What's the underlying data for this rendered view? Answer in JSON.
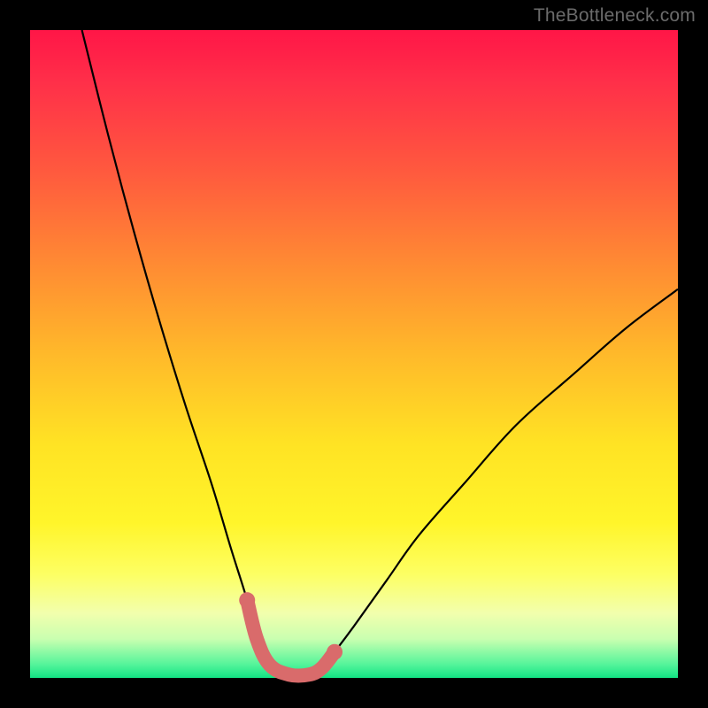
{
  "watermark": "TheBottleneck.com",
  "colors": {
    "frame": "#000000",
    "curve": "#000000",
    "highlight": "#d96b6b",
    "gradient_top": "#ff1647",
    "gradient_bottom": "#12e283"
  },
  "chart_data": {
    "type": "line",
    "title": "",
    "xlabel": "",
    "ylabel": "",
    "xlim": [
      0,
      100
    ],
    "ylim": [
      0,
      100
    ],
    "description": "Bottleneck-style V curve. Y is bottleneck percentage (high=red/bad near top, low=green/good near bottom). The curve descends steeply from top-left, reaches a flat minimum near zero around x 36–46, then rises with decreasing slope toward the right edge reaching about y 60 at x=100.",
    "series": [
      {
        "name": "bottleneck-curve",
        "x": [
          8,
          12,
          16,
          20,
          24,
          28,
          31,
          33.5,
          35,
          37,
          40,
          43,
          45,
          47,
          50,
          55,
          60,
          67,
          75,
          84,
          92,
          100
        ],
        "y": [
          100,
          84,
          69,
          55,
          42,
          30,
          20,
          12,
          6,
          2,
          0.5,
          0.5,
          1.5,
          4,
          8,
          15,
          22,
          30,
          39,
          47,
          54,
          60
        ]
      }
    ],
    "highlight_region": {
      "name": "optimal-range",
      "x": [
        33.5,
        35,
        37,
        40,
        43,
        45,
        47
      ],
      "y": [
        12,
        6,
        2,
        0.5,
        0.5,
        1.5,
        4
      ]
    }
  }
}
